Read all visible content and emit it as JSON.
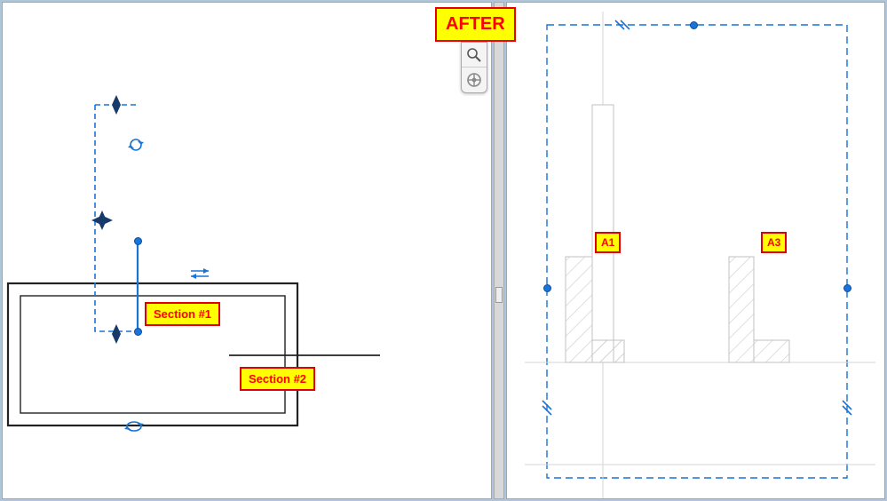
{
  "header_annotation": "AFTER",
  "left": {
    "label_section1": "Section #1",
    "label_section2": "Section #2"
  },
  "right": {
    "label_a1": "A1",
    "label_a3": "A3"
  },
  "toolbox": {
    "magnify_icon": "magnifier-icon",
    "wheel_icon": "steering-icon"
  }
}
